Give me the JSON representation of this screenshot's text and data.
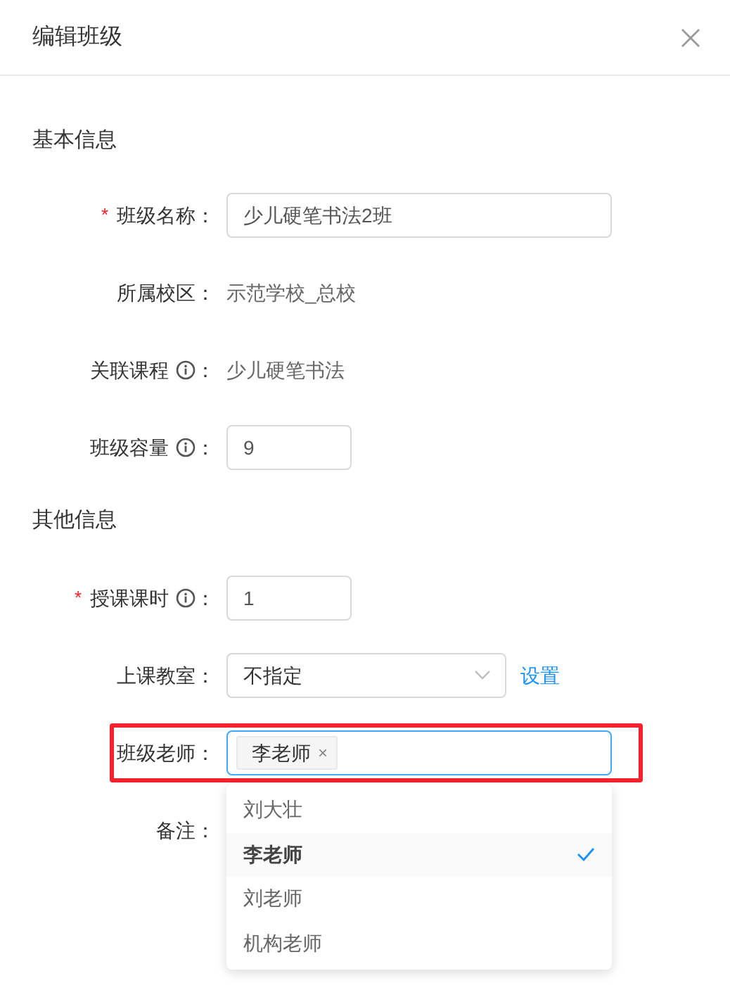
{
  "dialog": {
    "title": "编辑班级"
  },
  "sections": [
    {
      "heading": "基本信息",
      "fields": [
        {
          "kind": "wide-input",
          "label": "班级名称",
          "colon": "：",
          "required_mark": "*",
          "info": false,
          "value": "少儿硬笔书法2班"
        },
        {
          "kind": "text",
          "label": "所属校区",
          "colon": "：",
          "info": false,
          "value": "示范学校_总校"
        },
        {
          "kind": "text",
          "label": "关联课程",
          "colon": "：",
          "info": true,
          "value": "少儿硬笔书法"
        },
        {
          "kind": "number-input",
          "label": "班级容量",
          "colon": "：",
          "info": true,
          "value": "9"
        }
      ]
    },
    {
      "heading": "其他信息",
      "fields": [
        {
          "kind": "number-input",
          "label": "授课课时",
          "colon": "：",
          "required_mark": "*",
          "info": true,
          "value": "1"
        },
        {
          "kind": "select",
          "label": "上课教室",
          "colon": "：",
          "info": false,
          "value": "不指定",
          "link": "设置"
        },
        {
          "kind": "tags",
          "label": "班级老师",
          "colon": "：",
          "info": false,
          "highlighted": true,
          "tags": [
            {
              "label": "李老师",
              "remove": "×"
            }
          ],
          "options": [
            {
              "label": "刘大壮",
              "selected": false
            },
            {
              "label": "李老师",
              "selected": true
            },
            {
              "label": "刘老师",
              "selected": false
            },
            {
              "label": "机构老师",
              "selected": false
            }
          ]
        },
        {
          "kind": "note",
          "label": "备注",
          "colon": "：",
          "info": false
        }
      ]
    }
  ]
}
